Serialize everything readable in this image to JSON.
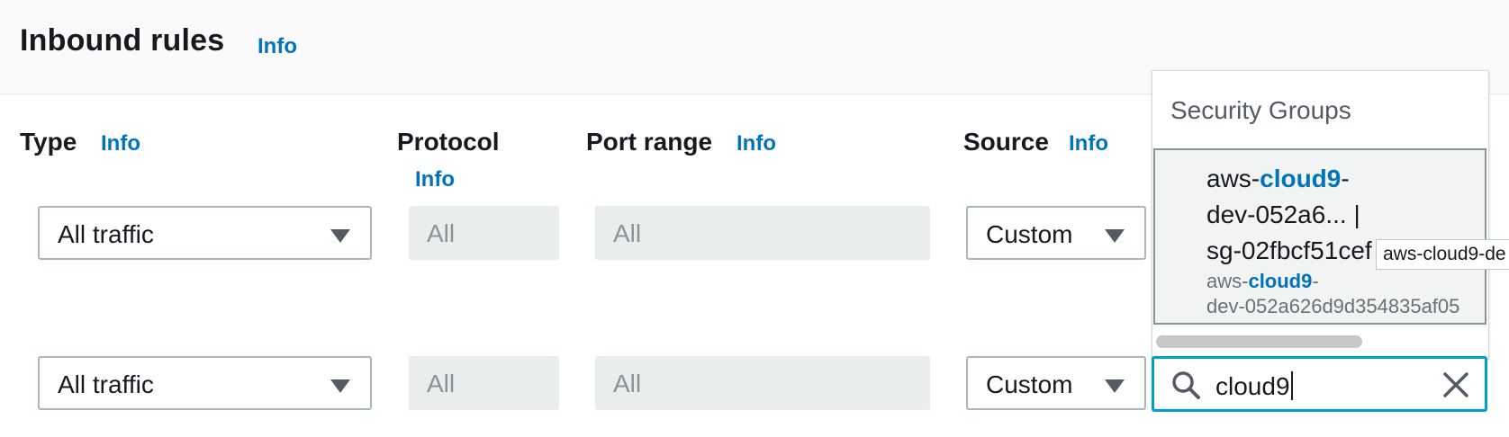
{
  "header": {
    "title": "Inbound rules",
    "info": "Info"
  },
  "columns": {
    "type": {
      "label": "Type",
      "info": "Info"
    },
    "protocol": {
      "label": "Protocol",
      "info": "Info"
    },
    "port_range": {
      "label": "Port range",
      "info": "Info"
    },
    "source": {
      "label": "Source",
      "info": "Info"
    }
  },
  "rows": [
    {
      "type": "All traffic",
      "protocol": "All",
      "port_range": "All",
      "source": "Custom"
    },
    {
      "type": "All traffic",
      "protocol": "All",
      "port_range": "All",
      "source": "Custom"
    }
  ],
  "dropdown": {
    "group_label": "Security Groups",
    "option": {
      "line1_prefix": "aws-",
      "line1_match": "cloud9",
      "line1_suffix": "-",
      "line2": "dev-052a6... |",
      "line3": "sg-02fbcf51cef",
      "desc1_prefix": "aws-",
      "desc1_match": "cloud9",
      "desc1_suffix": "-",
      "desc2": "dev-052a626d9d354835af05"
    }
  },
  "tooltip": {
    "text": "aws-cloud9-de"
  },
  "search": {
    "value": "cloud9"
  },
  "icons": {
    "search": "search-icon",
    "clear": "close-icon",
    "caret": "caret-down-icon"
  },
  "colors": {
    "link": "#0073bb",
    "focus": "#00a1c9",
    "highlight": "#0073bb"
  }
}
